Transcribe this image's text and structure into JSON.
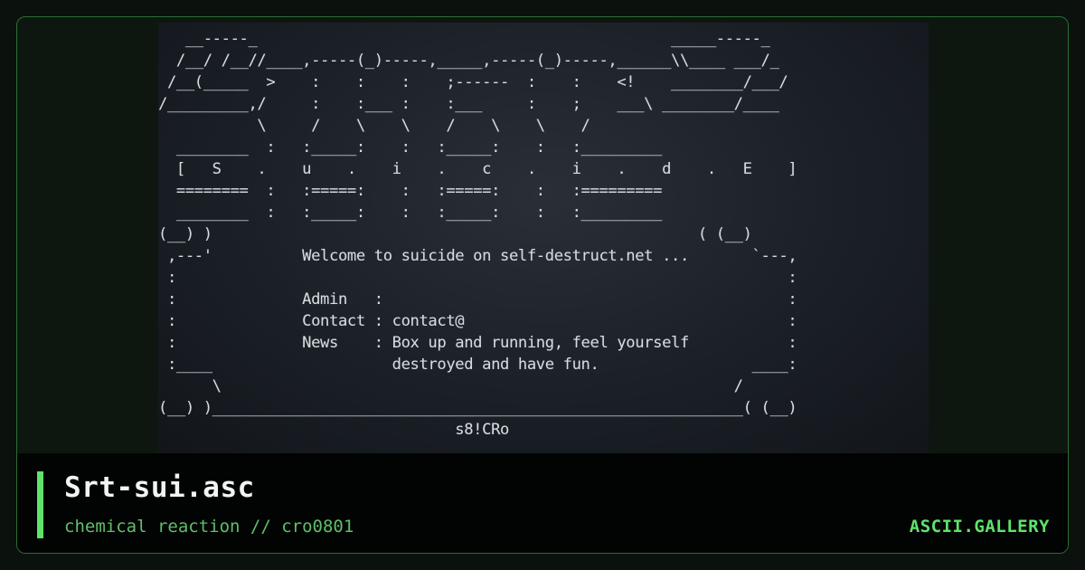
{
  "artwork": {
    "lines": [
      "   __-----_                                              _____-----_",
      "  /__/ /__//____,-----(_)-----,_____,-----(_)-----,______\\\\____ ___/_",
      " /__(_____  >    :    :    :    ;------  :    :    <!    ________/___/",
      "/_________,/     :    :___ :    :___     :    ;    ___\\ ________/____",
      "           \\     /    \\    \\    /    \\    \\    /",
      "  ________  :   :_____:    :   :_____:    :   :_________",
      "  [   S    .    u    .    i    .    c    .    i    .    d    .   E    ]",
      "  ========  :   :=====:    :   :=====:    :   :=========",
      "  ________  :   :_____:    :   :_____:    :   :_________",
      "(__) )                                                      ( (__)",
      " ,---'          Welcome to suicide on self-destruct.net ...       `---,",
      " :                                                                    :",
      " :              Admin   :                                             :",
      " :              Contact : contact@                                    :",
      " :              News    : Box up and running, feel yourself           :",
      " :____                    destroyed and have fun.                 ____:",
      "      \\                                                         /",
      "(__) )___________________________________________________________( (__)",
      "                                 s8!CRo"
    ]
  },
  "footer": {
    "title": "Srt-sui.asc",
    "subtitle": "chemical reaction // cro0801",
    "brand": "ASCII.GALLERY"
  }
}
